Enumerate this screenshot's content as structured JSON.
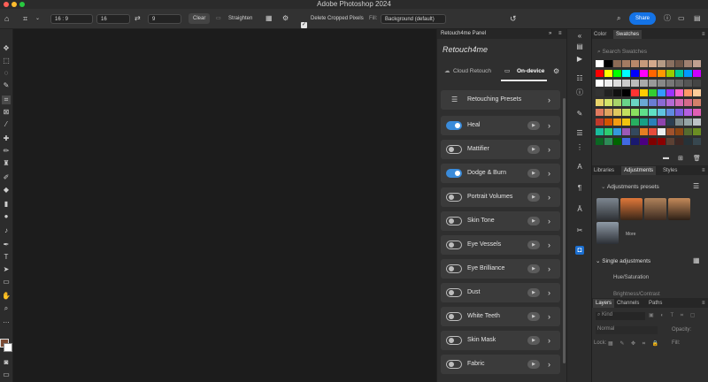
{
  "window": {
    "title": "Adobe Photoshop 2024"
  },
  "options": {
    "ratio": "16 : 9",
    "width": "16",
    "height": "9",
    "clear": "Clear",
    "straighten": "Straighten",
    "delete_cropped": "Delete Cropped Pixels",
    "fill_label": "Fill:",
    "fill_value": "Background (default)",
    "share": "Share"
  },
  "retouch": {
    "panel_title": "Retouch4me Panel",
    "logo": "Retouch4me",
    "tab_cloud": "Cloud Retouch",
    "tab_device": "On-device",
    "presets_label": "Retouching Presets",
    "items": [
      {
        "label": "Heal",
        "on": true
      },
      {
        "label": "Mattifier",
        "on": false
      },
      {
        "label": "Dodge & Burn",
        "on": true
      },
      {
        "label": "Portrait Volumes",
        "on": false
      },
      {
        "label": "Skin Tone",
        "on": false
      },
      {
        "label": "Eye Vessels",
        "on": false
      },
      {
        "label": "Eye Brilliance",
        "on": false
      },
      {
        "label": "Dust",
        "on": false
      },
      {
        "label": "White Teeth",
        "on": false
      },
      {
        "label": "Skin Mask",
        "on": false
      },
      {
        "label": "Fabric",
        "on": false
      }
    ]
  },
  "swatches": {
    "tab_color": "Color",
    "tab_swatches": "Swatches",
    "search_placeholder": "Search Swatches",
    "row1": [
      "#ffffff",
      "#000000",
      "#8b6a55",
      "#a47b62",
      "#b8896a",
      "#c79a7b",
      "#d3a98c",
      "#b59b85",
      "#8a7060",
      "#6d5548",
      "#a08070",
      "#c0a090"
    ],
    "row2": [
      "#ff0000",
      "#ffff00",
      "#00ff00",
      "#00ffff",
      "#0000ff",
      "#ff00ff",
      "#ff6600",
      "#ff9900",
      "#99cc00",
      "#00cc99",
      "#0099ff",
      "#cc00ff"
    ],
    "row3": [
      "#ffffff",
      "#eeeeee",
      "#dddddd",
      "#cccccc",
      "#bbbbbb",
      "#aaaaaa",
      "#999999",
      "#888888",
      "#777777",
      "#666666",
      "#555555",
      "#444444"
    ],
    "row4": [
      "#333333",
      "#222222",
      "#111111",
      "#000000",
      "#ff3333",
      "#ffcc00",
      "#33cc33",
      "#3399ff",
      "#9933ff",
      "#ff66cc",
      "#ff9966",
      "#ffcc99"
    ],
    "row5": [
      "#e8d36a",
      "#d4e36a",
      "#a8d46a",
      "#6ad48a",
      "#6ad4c4",
      "#6aa8d4",
      "#6a7cd4",
      "#8a6ad4",
      "#b46ad4",
      "#d46ab4",
      "#d46a8a",
      "#d4806a"
    ],
    "row6": [
      "#e07a5f",
      "#e0a35f",
      "#e0c95f",
      "#c4e05f",
      "#8ae05f",
      "#5fe08a",
      "#5fe0c4",
      "#5fc4e0",
      "#5f8ae0",
      "#7a5fe0",
      "#b45fe0",
      "#e05fb4"
    ],
    "row7": [
      "#c0392b",
      "#d35400",
      "#f39c12",
      "#f1c40f",
      "#27ae60",
      "#16a085",
      "#2980b9",
      "#8e44ad",
      "#2c3e50",
      "#7f8c8d",
      "#95a5a6",
      "#bdc3c7"
    ],
    "row8": [
      "#1abc9c",
      "#2ecc71",
      "#3498db",
      "#9b59b6",
      "#34495e",
      "#e67e22",
      "#e74c3c",
      "#ecf0f1",
      "#a0522d",
      "#8b4513",
      "#556b2f",
      "#6b8e23"
    ],
    "row9": [
      "#0b6623",
      "#2e8b57",
      "#006400",
      "#4169e1",
      "#191970",
      "#4b0082",
      "#800000",
      "#8b0000",
      "#5c4033",
      "#3e2723",
      "#263238",
      "#37474f"
    ]
  },
  "adjustments": {
    "tab_libraries": "Libraries",
    "tab_adjustments": "Adjustments",
    "tab_styles": "Styles",
    "presets_label": "Adjustments presets",
    "more_label": "More",
    "single_label": "Single adjustments",
    "item1": "Hue/Saturation",
    "item2": "Brightness/Contrast"
  },
  "layers": {
    "tab_layers": "Layers",
    "tab_channels": "Channels",
    "tab_paths": "Paths",
    "kind": "Kind",
    "blend": "Normal",
    "opacity": "Opacity:",
    "lock": "Lock:",
    "fill": "Fill:"
  }
}
